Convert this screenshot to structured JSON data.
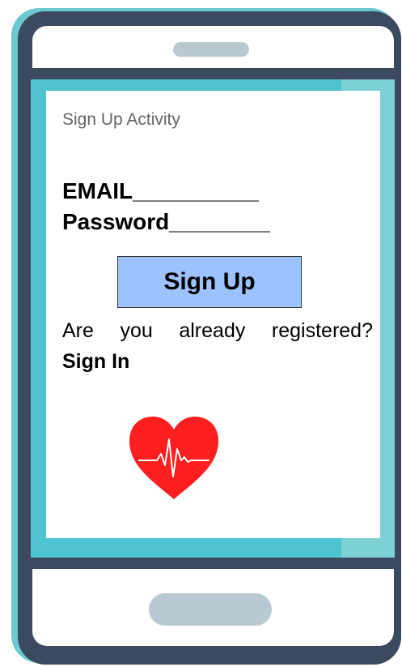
{
  "screen": {
    "title": "Sign Up Activity",
    "email_label": "EMAIL__________",
    "password_label": "Password________",
    "signup_button_label": "Sign Up",
    "registered_prompt": "Are you already registered?",
    "signin_link_label": "Sign In"
  },
  "icons": {
    "heart": "heart-pulse-icon",
    "speaker": "speaker-grille",
    "home": "home-button"
  },
  "colors": {
    "phone_body": "#3b4a5e",
    "screen_frame": "#4fc3cf",
    "signup_button": "#9dc3ff",
    "heart": "#ff1f1f"
  }
}
